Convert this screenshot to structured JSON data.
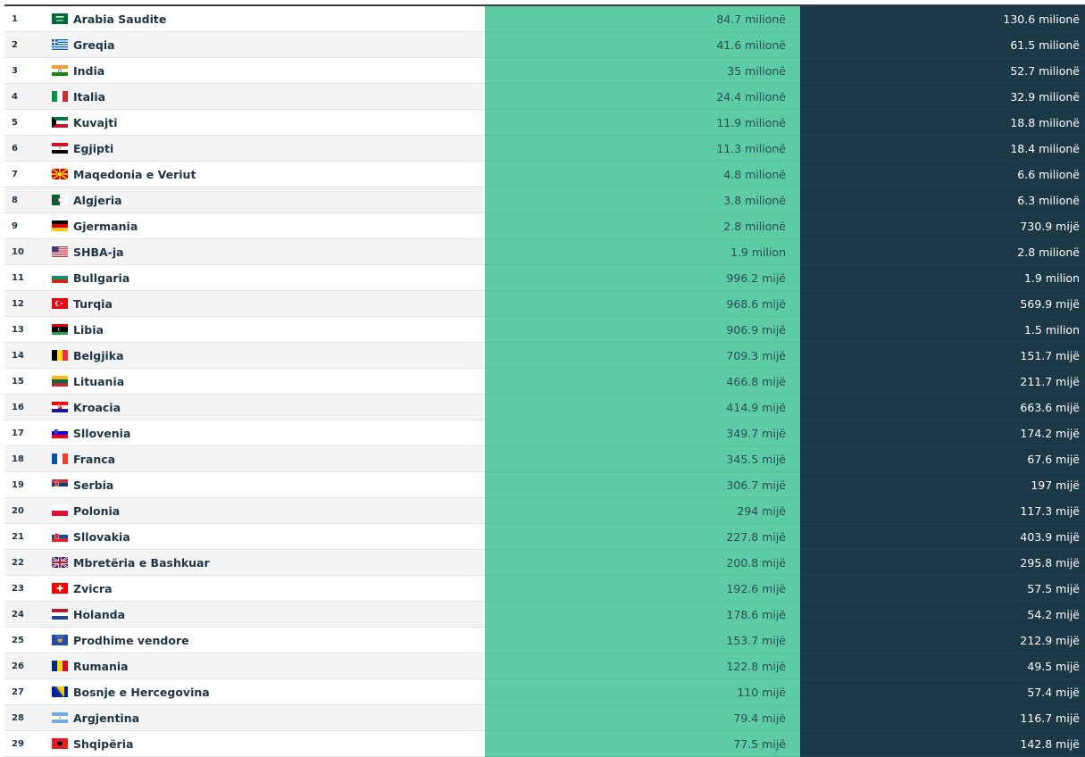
{
  "rows": [
    {
      "rank": "1",
      "country": "Arabia Saudite",
      "flag": "sa",
      "v1": "84.7 milionë",
      "v2": "130.6 milionë"
    },
    {
      "rank": "2",
      "country": "Greqia",
      "flag": "gr",
      "v1": "41.6 milionë",
      "v2": "61.5 milionë"
    },
    {
      "rank": "3",
      "country": "India",
      "flag": "in",
      "v1": "35 milionë",
      "v2": "52.7 milionë"
    },
    {
      "rank": "4",
      "country": "Italia",
      "flag": "it",
      "v1": "24.4 milionë",
      "v2": "32.9 milionë"
    },
    {
      "rank": "5",
      "country": "Kuvajti",
      "flag": "kw",
      "v1": "11.9 milionë",
      "v2": "18.8 milionë"
    },
    {
      "rank": "6",
      "country": "Egjipti",
      "flag": "eg",
      "v1": "11.3 milionë",
      "v2": "18.4 milionë"
    },
    {
      "rank": "7",
      "country": "Maqedonia e Veriut",
      "flag": "mk",
      "v1": "4.8 milionë",
      "v2": "6.6 milionë"
    },
    {
      "rank": "8",
      "country": "Algjeria",
      "flag": "dz",
      "v1": "3.8 milionë",
      "v2": "6.3 milionë"
    },
    {
      "rank": "9",
      "country": "Gjermania",
      "flag": "de",
      "v1": "2.8 milionë",
      "v2": "730.9 mijë"
    },
    {
      "rank": "10",
      "country": "SHBA-ja",
      "flag": "us",
      "v1": "1.9 milion",
      "v2": "2.8 milionë"
    },
    {
      "rank": "11",
      "country": "Bullgaria",
      "flag": "bg",
      "v1": "996.2 mijë",
      "v2": "1.9 milion"
    },
    {
      "rank": "12",
      "country": "Turqia",
      "flag": "tr",
      "v1": "968.6 mijë",
      "v2": "569.9 mijë"
    },
    {
      "rank": "13",
      "country": "Libia",
      "flag": "ly",
      "v1": "906.9 mijë",
      "v2": "1.5 milion"
    },
    {
      "rank": "14",
      "country": "Belgjika",
      "flag": "be",
      "v1": "709.3 mijë",
      "v2": "151.7 mijë"
    },
    {
      "rank": "15",
      "country": "Lituania",
      "flag": "lt",
      "v1": "466.8 mijë",
      "v2": "211.7 mijë"
    },
    {
      "rank": "16",
      "country": "Kroacia",
      "flag": "hr",
      "v1": "414.9 mijë",
      "v2": "663.6 mijë"
    },
    {
      "rank": "17",
      "country": "Sllovenia",
      "flag": "si",
      "v1": "349.7 mijë",
      "v2": "174.2 mijë"
    },
    {
      "rank": "18",
      "country": "Franca",
      "flag": "fr",
      "v1": "345.5 mijë",
      "v2": "67.6 mijë"
    },
    {
      "rank": "19",
      "country": "Serbia",
      "flag": "rs",
      "v1": "306.7 mijë",
      "v2": "197 mijë"
    },
    {
      "rank": "20",
      "country": "Polonia",
      "flag": "pl",
      "v1": "294 mijë",
      "v2": "117.3 mijë"
    },
    {
      "rank": "21",
      "country": "Sllovakia",
      "flag": "sk",
      "v1": "227.8 mijë",
      "v2": "403.9 mijë"
    },
    {
      "rank": "22",
      "country": "Mbretëria e Bashkuar",
      "flag": "gb",
      "v1": "200.8 mijë",
      "v2": "295.8 mijë"
    },
    {
      "rank": "23",
      "country": "Zvicra",
      "flag": "ch",
      "v1": "192.6 mijë",
      "v2": "57.5 mijë"
    },
    {
      "rank": "24",
      "country": "Holanda",
      "flag": "nl",
      "v1": "178.6 mijë",
      "v2": "54.2 mijë"
    },
    {
      "rank": "25",
      "country": "Prodhime vendore",
      "flag": "xk",
      "v1": "153.7 mijë",
      "v2": "212.9 mijë"
    },
    {
      "rank": "26",
      "country": "Rumania",
      "flag": "ro",
      "v1": "122.8 mijë",
      "v2": "49.5 mijë"
    },
    {
      "rank": "27",
      "country": "Bosnje e Hercegovina",
      "flag": "ba",
      "v1": "110 mijë",
      "v2": "57.4 mijë"
    },
    {
      "rank": "28",
      "country": "Argjentina",
      "flag": "ar",
      "v1": "79.4 mijë",
      "v2": "116.7 mijë"
    },
    {
      "rank": "29",
      "country": "Shqipëria",
      "flag": "al",
      "v1": "77.5 mijë",
      "v2": "142.8 mijë"
    }
  ]
}
